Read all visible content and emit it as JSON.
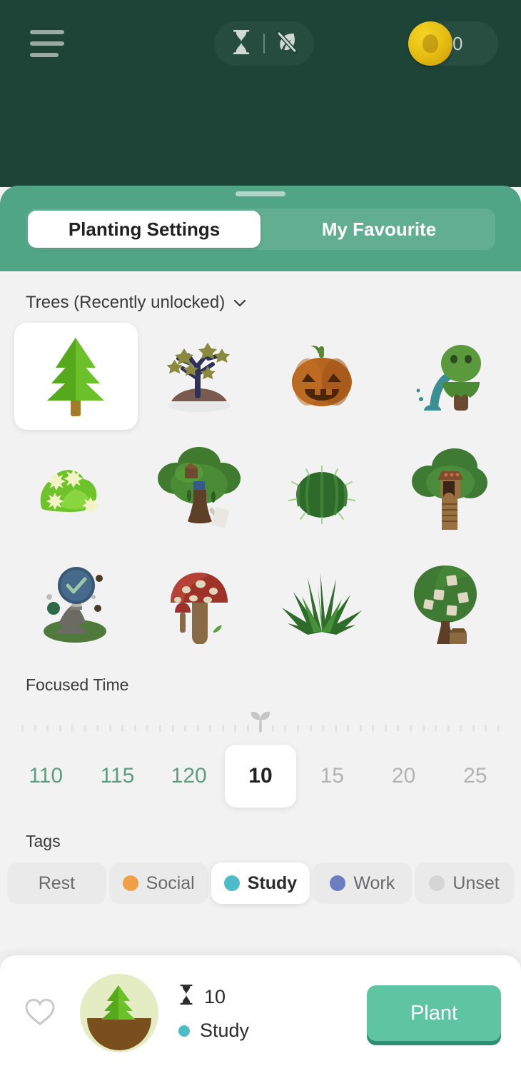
{
  "header": {
    "menu_icon": "hamburger-menu-icon",
    "timer_mode_icon": "hourglass-icon",
    "deep_focus_icon": "leaf-off-icon",
    "coin_icon": "gold-coin-icon",
    "coin_count": "0",
    "background_color": "#1d4437"
  },
  "sheet": {
    "accent_color": "#51a587",
    "tabs": [
      {
        "label": "Planting Settings",
        "active": true
      },
      {
        "label": "My Favourite",
        "active": false
      }
    ]
  },
  "trees_section": {
    "title": "Trees (Recently unlocked)",
    "expand_icon": "chevron-down-icon",
    "items": [
      {
        "name": "cedar-tree",
        "selected": true
      },
      {
        "name": "joshua-tree",
        "selected": false
      },
      {
        "name": "jack-o-lantern-pumpkin",
        "selected": false
      },
      {
        "name": "ghost-tree",
        "selected": false
      },
      {
        "name": "flower-bush",
        "selected": false
      },
      {
        "name": "treehouse-oak",
        "selected": false
      },
      {
        "name": "barrel-cactus",
        "selected": false
      },
      {
        "name": "tower-treehouse",
        "selected": false
      },
      {
        "name": "portal-rock",
        "selected": false
      },
      {
        "name": "red-mushroom",
        "selected": false
      },
      {
        "name": "agave-plant",
        "selected": false
      },
      {
        "name": "note-tree",
        "selected": false
      }
    ]
  },
  "focused_time": {
    "title": "Focused Time",
    "marker_icon": "sprout-icon",
    "options": [
      {
        "value": "110",
        "state": "past"
      },
      {
        "value": "115",
        "state": "past"
      },
      {
        "value": "120",
        "state": "past"
      },
      {
        "value": "10",
        "state": "selected"
      },
      {
        "value": "15",
        "state": "upcoming"
      },
      {
        "value": "20",
        "state": "upcoming"
      },
      {
        "value": "25",
        "state": "upcoming"
      }
    ],
    "selected_value": "10"
  },
  "tags": {
    "title": "Tags",
    "items": [
      {
        "label": "Rest",
        "color": "",
        "selected": false,
        "has_dot": false
      },
      {
        "label": "Social",
        "color": "#f0a046",
        "selected": false,
        "has_dot": true
      },
      {
        "label": "Study",
        "color": "#4cbcc8",
        "selected": true,
        "has_dot": true
      },
      {
        "label": "Work",
        "color": "#6b7fc0",
        "selected": false,
        "has_dot": true
      },
      {
        "label": "Unset",
        "color": "#d5d5d5",
        "selected": false,
        "has_dot": true
      }
    ],
    "selected_label": "Study"
  },
  "bottom_bar": {
    "favourite_icon": "heart-outline-icon",
    "preview_tree": "cedar-tree",
    "duration_icon": "hourglass-icon",
    "duration": "10",
    "tag_label": "Study",
    "tag_color": "#4cbcc8",
    "plant_label": "Plant",
    "plant_color": "#5fc4a2"
  }
}
